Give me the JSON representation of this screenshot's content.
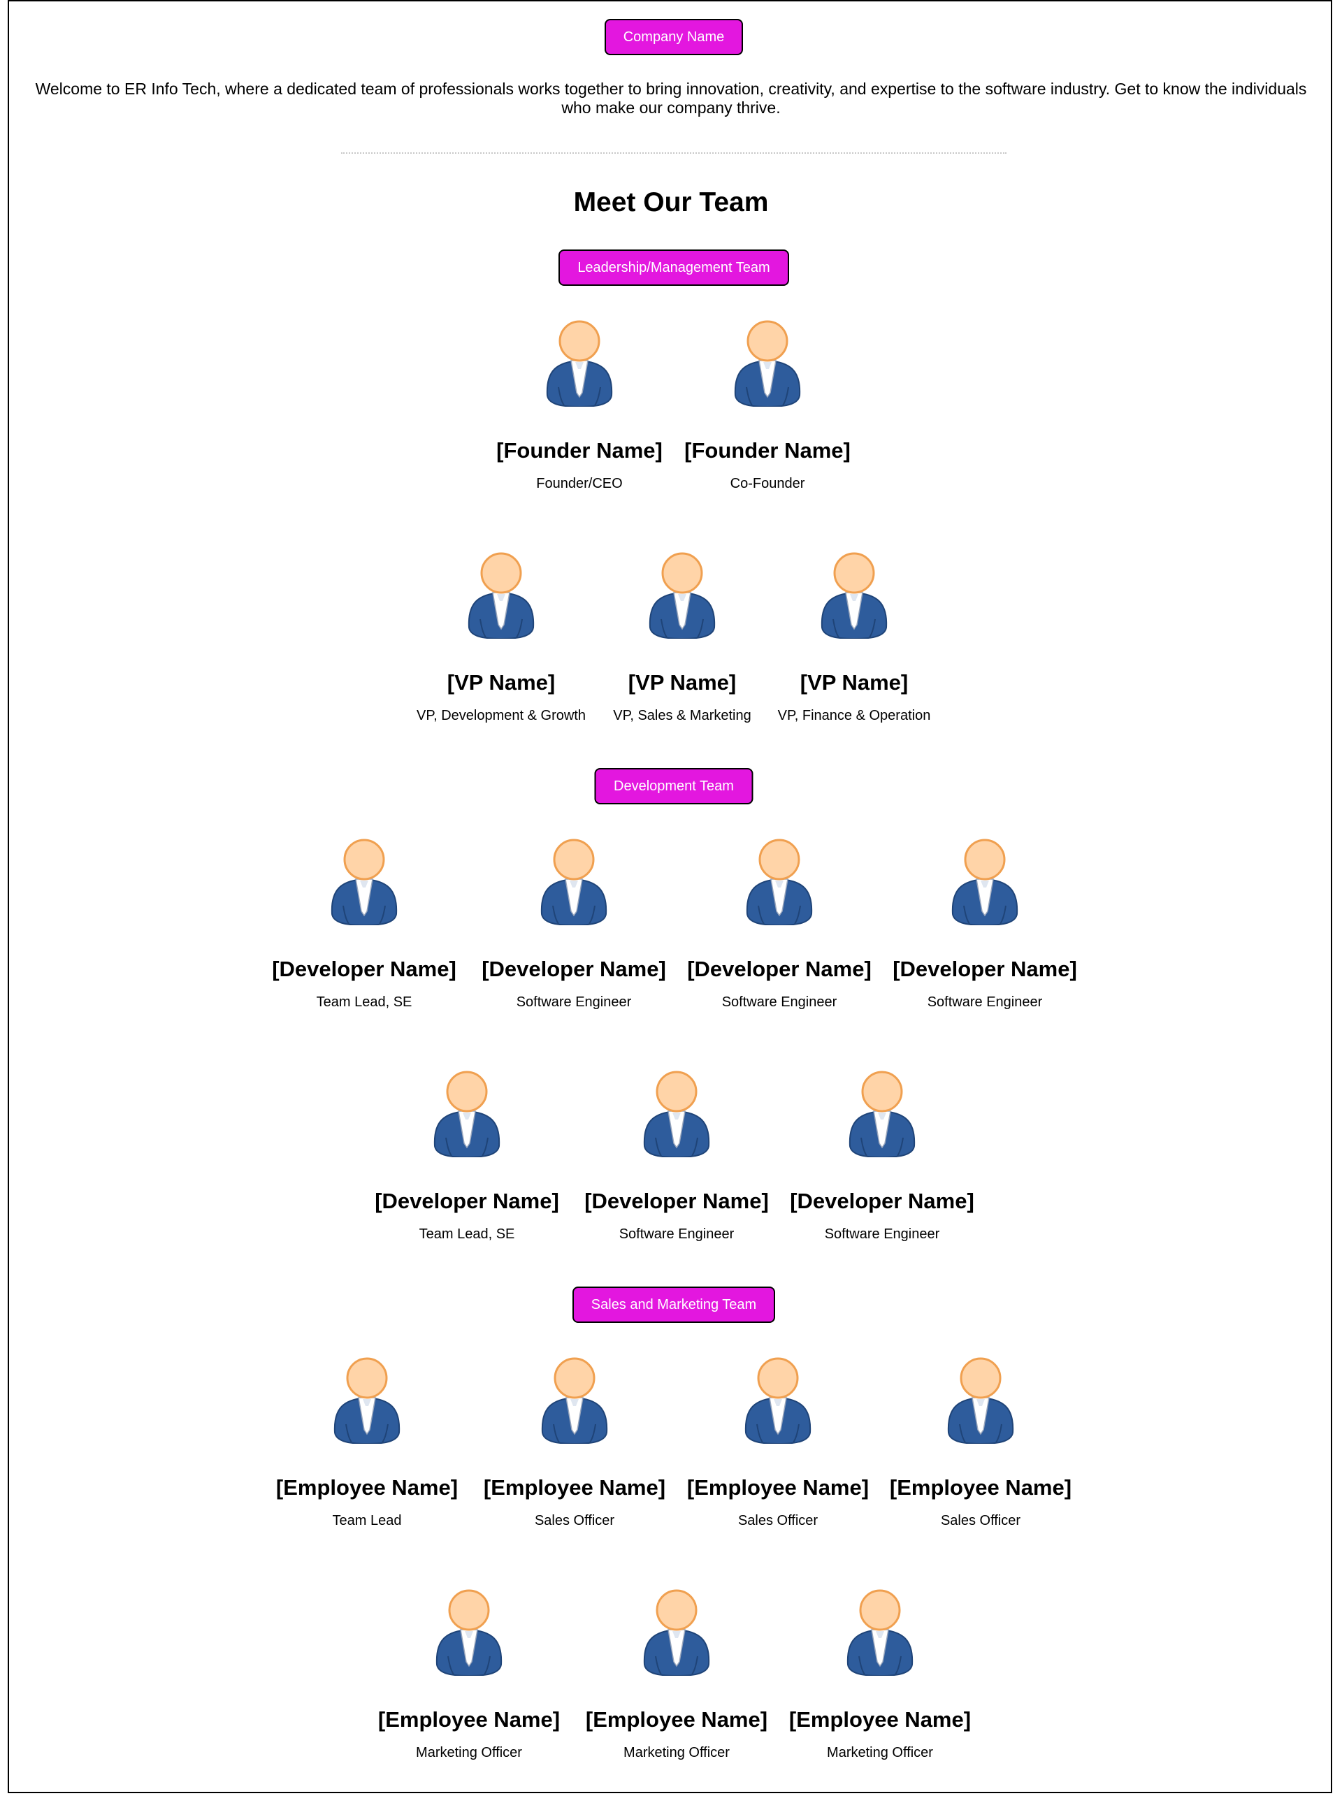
{
  "header": {
    "company_button": "Company Name"
  },
  "intro": "Welcome to ER Info Tech, where a dedicated team of professionals works together to bring innovation, creativity, and expertise to the software industry. Get to know the individuals who make our company thrive.",
  "heading": "Meet Our Team",
  "colors": {
    "accent": "#e317df",
    "suit": "#2e5c9c",
    "skin": "#ffd4a8",
    "skin_outline": "#f0a050"
  },
  "sections": [
    {
      "label": "Leadership/Management Team",
      "rows": [
        [
          {
            "name": "[Founder Name]",
            "role": "Founder/CEO"
          },
          {
            "name": "[Founder Name]",
            "role": "Co-Founder"
          }
        ],
        [
          {
            "name": "[VP Name]",
            "role": "VP, Development & Growth"
          },
          {
            "name": "[VP Name]",
            "role": "VP, Sales & Marketing"
          },
          {
            "name": "[VP Name]",
            "role": "VP, Finance & Operation"
          }
        ]
      ]
    },
    {
      "label": "Development Team",
      "rows": [
        [
          {
            "name": "[Developer Name]",
            "role": "Team Lead, SE"
          },
          {
            "name": "[Developer Name]",
            "role": "Software Engineer"
          },
          {
            "name": "[Developer Name]",
            "role": "Software Engineer"
          },
          {
            "name": "[Developer Name]",
            "role": "Software Engineer"
          }
        ],
        [
          {
            "name": "[Developer Name]",
            "role": "Team Lead, SE"
          },
          {
            "name": "[Developer Name]",
            "role": "Software Engineer"
          },
          {
            "name": "[Developer Name]",
            "role": "Software Engineer"
          }
        ]
      ]
    },
    {
      "label": "Sales and Marketing Team",
      "rows": [
        [
          {
            "name": "[Employee Name]",
            "role": "Team Lead"
          },
          {
            "name": "[Employee Name]",
            "role": "Sales Officer"
          },
          {
            "name": "[Employee Name]",
            "role": "Sales Officer"
          },
          {
            "name": "[Employee Name]",
            "role": "Sales Officer"
          }
        ],
        [
          {
            "name": "[Employee Name]",
            "role": "Marketing Officer"
          },
          {
            "name": "[Employee Name]",
            "role": "Marketing Officer"
          },
          {
            "name": "[Employee Name]",
            "role": "Marketing Officer"
          }
        ]
      ]
    }
  ]
}
